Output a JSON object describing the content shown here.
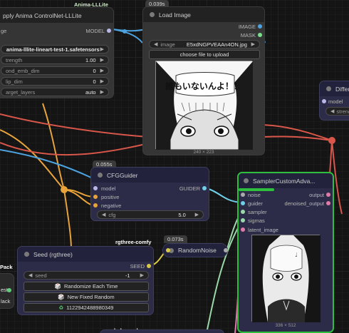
{
  "canvas": {
    "group_labels": {
      "anima": "Anima-LLLite",
      "rgthree": "rgthree-comfy",
      "hvbs": "hvbs-nodes",
      "pack": "Pack"
    }
  },
  "controlnet_node": {
    "title": "pply Anima ControlNet-LLLite",
    "inputs": [
      "ge"
    ],
    "outputs": [
      "MODEL"
    ],
    "widgets": [
      {
        "label": "",
        "value": "anima-lllite-lineart-test-1.safetensors"
      },
      {
        "label": "trength",
        "value": "1.00"
      },
      {
        "label": "ond_emb_dim",
        "value": "0"
      },
      {
        "label": "lip_dim",
        "value": "0"
      },
      {
        "label": "arget_layers",
        "value": "auto"
      }
    ]
  },
  "load_image_node": {
    "time_badge": "0.039s",
    "title": "Load Image",
    "outputs": [
      "IMAGE",
      "MASK"
    ],
    "image_widget": {
      "label": "image",
      "value": "E5xdNGPVEAAn4ON.jpg"
    },
    "upload_button": "choose file to upload",
    "preview_text": "誰もいないんよ！！",
    "preview_size": "240 × 223"
  },
  "diff_node": {
    "title": "Differ",
    "inputs": [
      "model"
    ],
    "widget": "streng"
  },
  "cfg_guider_node": {
    "time_badge": "0.055s",
    "title": "CFGGuider",
    "inputs": [
      "model",
      "positive",
      "negative"
    ],
    "outputs": [
      "GUIDER"
    ],
    "cfg_widget": {
      "label": "cfg",
      "value": "5.0"
    }
  },
  "sampler_node": {
    "title": "SamplerCustomAdva...",
    "inputs": [
      "noise",
      "guider",
      "sampler",
      "sigmas",
      "latent_image"
    ],
    "outputs": [
      "output",
      "denoised_output"
    ],
    "preview_size": "336 × 512"
  },
  "random_noise_node": {
    "time_badge": "0.073s",
    "title": "RandomNoise"
  },
  "seed_node": {
    "title": "Seed (rgthree)",
    "outputs": [
      "SEED"
    ],
    "seed_widget": {
      "label": "seed",
      "value": "-1"
    },
    "buttons": [
      "Randomize Each Time",
      "New Fixed Random",
      "1122942488980349"
    ]
  },
  "left_node": {
    "rows": [
      "est",
      "lack"
    ]
  },
  "colors": {
    "wire_blue": "#4da3e0",
    "wire_orange": "#e8a33a",
    "wire_red": "#d9574a",
    "wire_mint": "#9ad8a8",
    "wire_pink": "#e07aa8",
    "wire_yellow": "#d8c84a",
    "selected_border": "#2fbf3f",
    "node_navy": "#2c2c48",
    "node_dark": "#353535"
  }
}
